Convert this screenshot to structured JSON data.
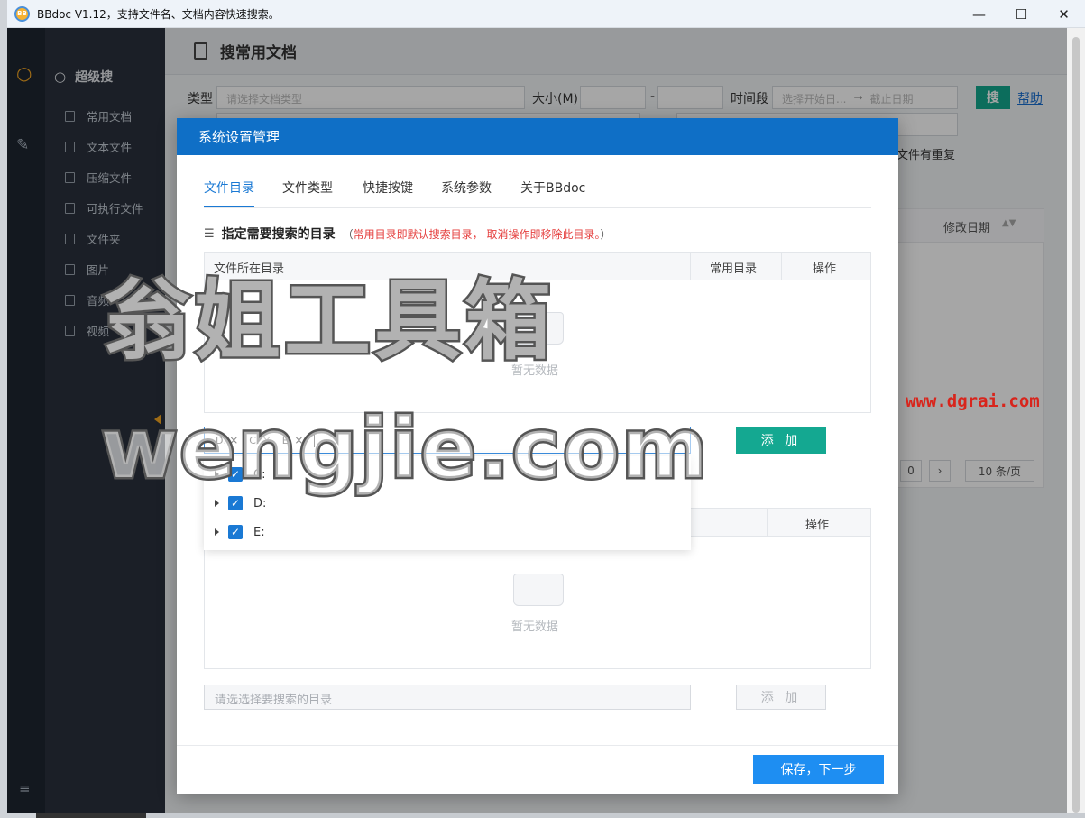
{
  "window": {
    "title": "BBdoc V1.12，支持文件名、文档内容快速搜索。",
    "logo_text": "BB",
    "minimize": "—",
    "maximize": "☐",
    "close": "✕"
  },
  "sidebar": {
    "heading": "超级搜",
    "items": [
      {
        "label": "常用文档"
      },
      {
        "label": "文本文件"
      },
      {
        "label": "压缩文件"
      },
      {
        "label": "可执行文件"
      },
      {
        "label": "文件夹"
      },
      {
        "label": "图片"
      },
      {
        "label": "音频"
      },
      {
        "label": "视频"
      }
    ]
  },
  "page": {
    "title": "搜常用文档",
    "filters": {
      "type_label": "类型",
      "type_placeholder": "请选择文档类型",
      "size_label": "大小(M)",
      "size_dash": "-",
      "period_label": "时间段",
      "start_placeholder": "选择开始日...",
      "arrow": "→",
      "end_placeholder": "截止日期",
      "search_button": "搜",
      "help_link": "帮助"
    },
    "duplicate_text": "文件有重复",
    "table_header_modified": "修改日期",
    "pager": {
      "page_value": "0",
      "page_size": "10 条/页"
    }
  },
  "modal": {
    "title": "系统设置管理",
    "tabs": [
      {
        "label": "文件目录",
        "active": true
      },
      {
        "label": "文件类型"
      },
      {
        "label": "快捷按键"
      },
      {
        "label": "系统参数"
      },
      {
        "label": "关于BBdoc"
      }
    ],
    "section_title": "指定需要搜索的目录",
    "section_hint_open": "（",
    "section_hint": "常用目录即默认搜索目录， 取消操作即移除此目录。",
    "section_hint_close": "）",
    "table1": {
      "columns": [
        "文件所在目录",
        "常用目录",
        "操作"
      ],
      "empty_text": "暂无数据"
    },
    "cascader": {
      "tags": [
        "D:",
        "C:",
        "E:"
      ],
      "add_button": "添 加",
      "options": [
        {
          "label": "C:",
          "checked": true
        },
        {
          "label": "D:",
          "checked": true
        },
        {
          "label": "E:",
          "checked": true
        }
      ]
    },
    "table2": {
      "columns": [
        "操作"
      ],
      "empty_text": "暂无数据"
    },
    "dir_input_placeholder": "请选选择要搜索的目录",
    "add_button2": "添 加",
    "save_button": "保存，下一步"
  },
  "watermark": {
    "line1": "翁姐工具箱",
    "line2": "wengjie.com",
    "url": "www.dgrai.com"
  },
  "colors": {
    "modal_header": "#0f6fc6",
    "primary": "#1e8ef2",
    "teal_button": "#14a891",
    "hint_red": "#e5403f",
    "sidebar_dark": "#2a313c",
    "accent_orange": "#f5a623"
  }
}
